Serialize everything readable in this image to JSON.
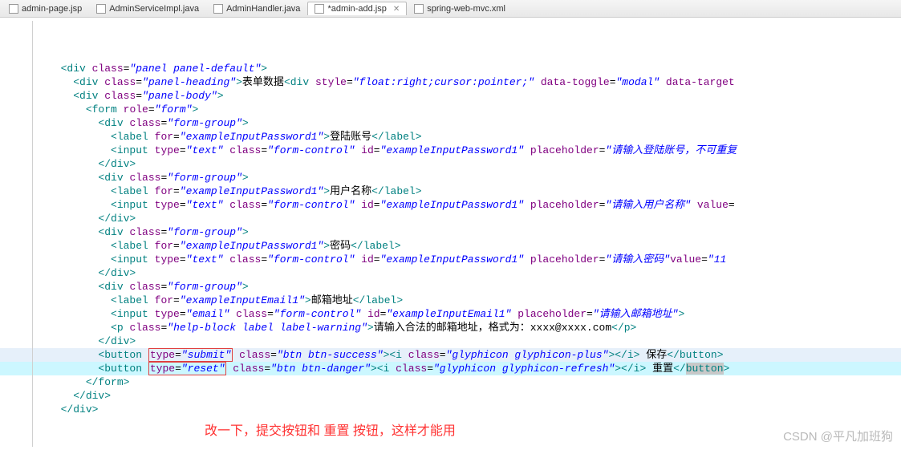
{
  "tabs": [
    {
      "label": "admin-page.jsp",
      "icon": "jsp-file-icon",
      "active": false
    },
    {
      "label": "AdminServiceImpl.java",
      "icon": "java-file-icon",
      "active": false
    },
    {
      "label": "AdminHandler.java",
      "icon": "java-file-icon",
      "active": false
    },
    {
      "label": "*admin-add.jsp",
      "icon": "jsp-file-icon",
      "active": true,
      "closeable": true
    },
    {
      "label": "spring-web-mvc.xml",
      "icon": "xml-file-icon",
      "active": false
    }
  ],
  "code": {
    "lines": [
      {
        "indent": 1,
        "tokens": [
          {
            "t": "tag",
            "v": "<div"
          },
          {
            "t": "sp"
          },
          {
            "t": "attr",
            "v": "class"
          },
          {
            "t": "eq",
            "v": "="
          },
          {
            "t": "val",
            "v": "\"panel panel-default\""
          },
          {
            "t": "tag",
            "v": ">"
          }
        ]
      },
      {
        "indent": 2,
        "tokens": [
          {
            "t": "tag",
            "v": "<div"
          },
          {
            "t": "sp"
          },
          {
            "t": "attr",
            "v": "class"
          },
          {
            "t": "eq",
            "v": "="
          },
          {
            "t": "val",
            "v": "\"panel-heading\""
          },
          {
            "t": "tag",
            "v": ">"
          },
          {
            "t": "txt",
            "v": "表单数据"
          },
          {
            "t": "tag",
            "v": "<div"
          },
          {
            "t": "sp"
          },
          {
            "t": "attr",
            "v": "style"
          },
          {
            "t": "eq",
            "v": "="
          },
          {
            "t": "val",
            "v": "\"float:right;cursor:pointer;\""
          },
          {
            "t": "sp"
          },
          {
            "t": "attr",
            "v": "data-toggle"
          },
          {
            "t": "eq",
            "v": "="
          },
          {
            "t": "val",
            "v": "\"modal\""
          },
          {
            "t": "sp"
          },
          {
            "t": "attr",
            "v": "data-target"
          }
        ]
      },
      {
        "indent": 2,
        "tokens": [
          {
            "t": "tag",
            "v": "<div"
          },
          {
            "t": "sp"
          },
          {
            "t": "attr",
            "v": "class"
          },
          {
            "t": "eq",
            "v": "="
          },
          {
            "t": "val",
            "v": "\"panel-body\""
          },
          {
            "t": "tag",
            "v": ">"
          }
        ]
      },
      {
        "indent": 3,
        "tokens": [
          {
            "t": "tag",
            "v": "<form"
          },
          {
            "t": "sp"
          },
          {
            "t": "attr",
            "v": "role"
          },
          {
            "t": "eq",
            "v": "="
          },
          {
            "t": "val",
            "v": "\"form\""
          },
          {
            "t": "tag",
            "v": ">"
          }
        ]
      },
      {
        "indent": 4,
        "tokens": [
          {
            "t": "tag",
            "v": "<div"
          },
          {
            "t": "sp"
          },
          {
            "t": "attr",
            "v": "class"
          },
          {
            "t": "eq",
            "v": "="
          },
          {
            "t": "val",
            "v": "\"form-group\""
          },
          {
            "t": "tag",
            "v": ">"
          }
        ]
      },
      {
        "indent": 5,
        "tokens": [
          {
            "t": "tag",
            "v": "<label"
          },
          {
            "t": "sp"
          },
          {
            "t": "attr",
            "v": "for"
          },
          {
            "t": "eq",
            "v": "="
          },
          {
            "t": "val",
            "v": "\"exampleInputPassword1\""
          },
          {
            "t": "tag",
            "v": ">"
          },
          {
            "t": "txt",
            "v": "登陆账号"
          },
          {
            "t": "tag",
            "v": "</label>"
          }
        ]
      },
      {
        "indent": 5,
        "tokens": [
          {
            "t": "tag",
            "v": "<input"
          },
          {
            "t": "sp"
          },
          {
            "t": "attr",
            "v": "type"
          },
          {
            "t": "eq",
            "v": "="
          },
          {
            "t": "val",
            "v": "\"text\""
          },
          {
            "t": "sp"
          },
          {
            "t": "attr",
            "v": "class"
          },
          {
            "t": "eq",
            "v": "="
          },
          {
            "t": "val",
            "v": "\"form-control\""
          },
          {
            "t": "sp"
          },
          {
            "t": "attr",
            "v": "id"
          },
          {
            "t": "eq",
            "v": "="
          },
          {
            "t": "val",
            "v": "\"exampleInputPassword1\""
          },
          {
            "t": "sp"
          },
          {
            "t": "attr",
            "v": "placeholder"
          },
          {
            "t": "eq",
            "v": "="
          },
          {
            "t": "val",
            "v": "\"请输入登陆账号，不可重复"
          }
        ]
      },
      {
        "indent": 4,
        "tokens": [
          {
            "t": "tag",
            "v": "</div>"
          }
        ]
      },
      {
        "indent": 4,
        "tokens": [
          {
            "t": "tag",
            "v": "<div"
          },
          {
            "t": "sp"
          },
          {
            "t": "attr",
            "v": "class"
          },
          {
            "t": "eq",
            "v": "="
          },
          {
            "t": "val",
            "v": "\"form-group\""
          },
          {
            "t": "tag",
            "v": ">"
          }
        ]
      },
      {
        "indent": 5,
        "tokens": [
          {
            "t": "tag",
            "v": "<label"
          },
          {
            "t": "sp"
          },
          {
            "t": "attr",
            "v": "for"
          },
          {
            "t": "eq",
            "v": "="
          },
          {
            "t": "val",
            "v": "\"exampleInputPassword1\""
          },
          {
            "t": "tag",
            "v": ">"
          },
          {
            "t": "txt",
            "v": "用户名称"
          },
          {
            "t": "tag",
            "v": "</label>"
          }
        ]
      },
      {
        "indent": 5,
        "tokens": [
          {
            "t": "tag",
            "v": "<input"
          },
          {
            "t": "sp"
          },
          {
            "t": "attr",
            "v": "type"
          },
          {
            "t": "eq",
            "v": "="
          },
          {
            "t": "val",
            "v": "\"text\""
          },
          {
            "t": "sp"
          },
          {
            "t": "attr",
            "v": "class"
          },
          {
            "t": "eq",
            "v": "="
          },
          {
            "t": "val",
            "v": "\"form-control\""
          },
          {
            "t": "sp"
          },
          {
            "t": "attr",
            "v": "id"
          },
          {
            "t": "eq",
            "v": "="
          },
          {
            "t": "val",
            "v": "\"exampleInputPassword1\""
          },
          {
            "t": "sp"
          },
          {
            "t": "attr",
            "v": "placeholder"
          },
          {
            "t": "eq",
            "v": "="
          },
          {
            "t": "val",
            "v": "\"请输入用户名称\""
          },
          {
            "t": "sp"
          },
          {
            "t": "attr",
            "v": "value"
          },
          {
            "t": "eq",
            "v": "="
          }
        ]
      },
      {
        "indent": 4,
        "tokens": [
          {
            "t": "tag",
            "v": "</div>"
          }
        ]
      },
      {
        "indent": 4,
        "tokens": [
          {
            "t": "tag",
            "v": "<div"
          },
          {
            "t": "sp"
          },
          {
            "t": "attr",
            "v": "class"
          },
          {
            "t": "eq",
            "v": "="
          },
          {
            "t": "val",
            "v": "\"form-group\""
          },
          {
            "t": "tag",
            "v": ">"
          }
        ]
      },
      {
        "indent": 5,
        "tokens": [
          {
            "t": "tag",
            "v": "<label"
          },
          {
            "t": "sp"
          },
          {
            "t": "attr",
            "v": "for"
          },
          {
            "t": "eq",
            "v": "="
          },
          {
            "t": "val",
            "v": "\"exampleInputPassword1\""
          },
          {
            "t": "tag",
            "v": ">"
          },
          {
            "t": "txt",
            "v": "密码"
          },
          {
            "t": "tag",
            "v": "</label>"
          }
        ]
      },
      {
        "indent": 5,
        "tokens": [
          {
            "t": "tag",
            "v": "<input"
          },
          {
            "t": "sp"
          },
          {
            "t": "attr",
            "v": "type"
          },
          {
            "t": "eq",
            "v": "="
          },
          {
            "t": "val",
            "v": "\"text\""
          },
          {
            "t": "sp"
          },
          {
            "t": "attr",
            "v": "class"
          },
          {
            "t": "eq",
            "v": "="
          },
          {
            "t": "val",
            "v": "\"form-control\""
          },
          {
            "t": "sp"
          },
          {
            "t": "attr",
            "v": "id"
          },
          {
            "t": "eq",
            "v": "="
          },
          {
            "t": "val",
            "v": "\"exampleInputPassword1\""
          },
          {
            "t": "sp"
          },
          {
            "t": "attr",
            "v": "placeholder"
          },
          {
            "t": "eq",
            "v": "="
          },
          {
            "t": "val",
            "v": "\"请输入密码\""
          },
          {
            "t": "attr",
            "v": "value"
          },
          {
            "t": "eq",
            "v": "="
          },
          {
            "t": "val",
            "v": "\"11"
          }
        ]
      },
      {
        "indent": 4,
        "tokens": [
          {
            "t": "tag",
            "v": "</div>"
          }
        ]
      },
      {
        "indent": 4,
        "tokens": [
          {
            "t": "tag",
            "v": "<div"
          },
          {
            "t": "sp"
          },
          {
            "t": "attr",
            "v": "class"
          },
          {
            "t": "eq",
            "v": "="
          },
          {
            "t": "val",
            "v": "\"form-group\""
          },
          {
            "t": "tag",
            "v": ">"
          }
        ]
      },
      {
        "indent": 5,
        "tokens": [
          {
            "t": "tag",
            "v": "<label"
          },
          {
            "t": "sp"
          },
          {
            "t": "attr",
            "v": "for"
          },
          {
            "t": "eq",
            "v": "="
          },
          {
            "t": "val",
            "v": "\"exampleInputEmail1\""
          },
          {
            "t": "tag",
            "v": ">"
          },
          {
            "t": "txt",
            "v": "邮箱地址"
          },
          {
            "t": "tag",
            "v": "</label>"
          }
        ]
      },
      {
        "indent": 5,
        "tokens": [
          {
            "t": "tag",
            "v": "<input"
          },
          {
            "t": "sp"
          },
          {
            "t": "attr",
            "v": "type"
          },
          {
            "t": "eq",
            "v": "="
          },
          {
            "t": "val",
            "v": "\"email\""
          },
          {
            "t": "sp"
          },
          {
            "t": "attr",
            "v": "class"
          },
          {
            "t": "eq",
            "v": "="
          },
          {
            "t": "val",
            "v": "\"form-control\""
          },
          {
            "t": "sp"
          },
          {
            "t": "attr",
            "v": "id"
          },
          {
            "t": "eq",
            "v": "="
          },
          {
            "t": "val",
            "v": "\"exampleInputEmail1\""
          },
          {
            "t": "sp"
          },
          {
            "t": "attr",
            "v": "placeholder"
          },
          {
            "t": "eq",
            "v": "="
          },
          {
            "t": "val",
            "v": "\"请输入邮箱地址\""
          },
          {
            "t": "tag",
            "v": ">"
          }
        ]
      },
      {
        "indent": 5,
        "tokens": [
          {
            "t": "tag",
            "v": "<p"
          },
          {
            "t": "sp"
          },
          {
            "t": "attr",
            "v": "class"
          },
          {
            "t": "eq",
            "v": "="
          },
          {
            "t": "val",
            "v": "\"help-block label label-warning\""
          },
          {
            "t": "tag",
            "v": ">"
          },
          {
            "t": "txt",
            "v": "请输入合法的邮箱地址，格式为：xxxx@xxxx.com"
          },
          {
            "t": "tag",
            "v": "</p>"
          }
        ]
      },
      {
        "indent": 4,
        "tokens": [
          {
            "t": "tag",
            "v": "</div>"
          }
        ]
      },
      {
        "indent": 4,
        "hl": true,
        "tokens": [
          {
            "t": "tag",
            "v": "<button"
          },
          {
            "t": "sp"
          },
          {
            "t": "boxstart"
          },
          {
            "t": "attr",
            "v": "type"
          },
          {
            "t": "eq",
            "v": "="
          },
          {
            "t": "val",
            "v": "\"submit\""
          },
          {
            "t": "boxend"
          },
          {
            "t": "sp"
          },
          {
            "t": "attr",
            "v": "class"
          },
          {
            "t": "eq",
            "v": "="
          },
          {
            "t": "val",
            "v": "\"btn btn-success\""
          },
          {
            "t": "tag",
            "v": "><i"
          },
          {
            "t": "sp"
          },
          {
            "t": "attr",
            "v": "class"
          },
          {
            "t": "eq",
            "v": "="
          },
          {
            "t": "val",
            "v": "\"glyphicon glyphicon-plus\""
          },
          {
            "t": "tag",
            "v": "></i>"
          },
          {
            "t": "txt",
            "v": " 保存"
          },
          {
            "t": "tag",
            "v": "</button>"
          }
        ]
      },
      {
        "indent": 4,
        "hl2": true,
        "tokens": [
          {
            "t": "tag",
            "v": "<button"
          },
          {
            "t": "sp"
          },
          {
            "t": "boxstart"
          },
          {
            "t": "attr",
            "v": "type"
          },
          {
            "t": "eq",
            "v": "="
          },
          {
            "t": "val",
            "v": "\"reset\""
          },
          {
            "t": "boxend"
          },
          {
            "t": "sp"
          },
          {
            "t": "attr",
            "v": "class"
          },
          {
            "t": "eq",
            "v": "="
          },
          {
            "t": "val",
            "v": "\"btn btn-danger\""
          },
          {
            "t": "tag",
            "v": "><i"
          },
          {
            "t": "sp"
          },
          {
            "t": "attr",
            "v": "class"
          },
          {
            "t": "eq",
            "v": "="
          },
          {
            "t": "val",
            "v": "\"glyphicon glyphicon-refresh\""
          },
          {
            "t": "tag",
            "v": "></i>"
          },
          {
            "t": "txt",
            "v": " 重置"
          },
          {
            "t": "tag",
            "v": "</"
          },
          {
            "t": "tag-hl",
            "v": "button"
          },
          {
            "t": "tag",
            "v": ">"
          }
        ]
      },
      {
        "indent": 3,
        "tokens": [
          {
            "t": "tag",
            "v": "</form>"
          }
        ]
      },
      {
        "indent": 2,
        "tokens": [
          {
            "t": "tag",
            "v": "</div>"
          }
        ]
      },
      {
        "indent": 1,
        "tokens": [
          {
            "t": "tag",
            "v": "</div>"
          }
        ]
      }
    ]
  },
  "annotation": "改一下，提交按钮和 重置 按钮，这样才能用",
  "watermark": "CSDN @平凡加班狗"
}
